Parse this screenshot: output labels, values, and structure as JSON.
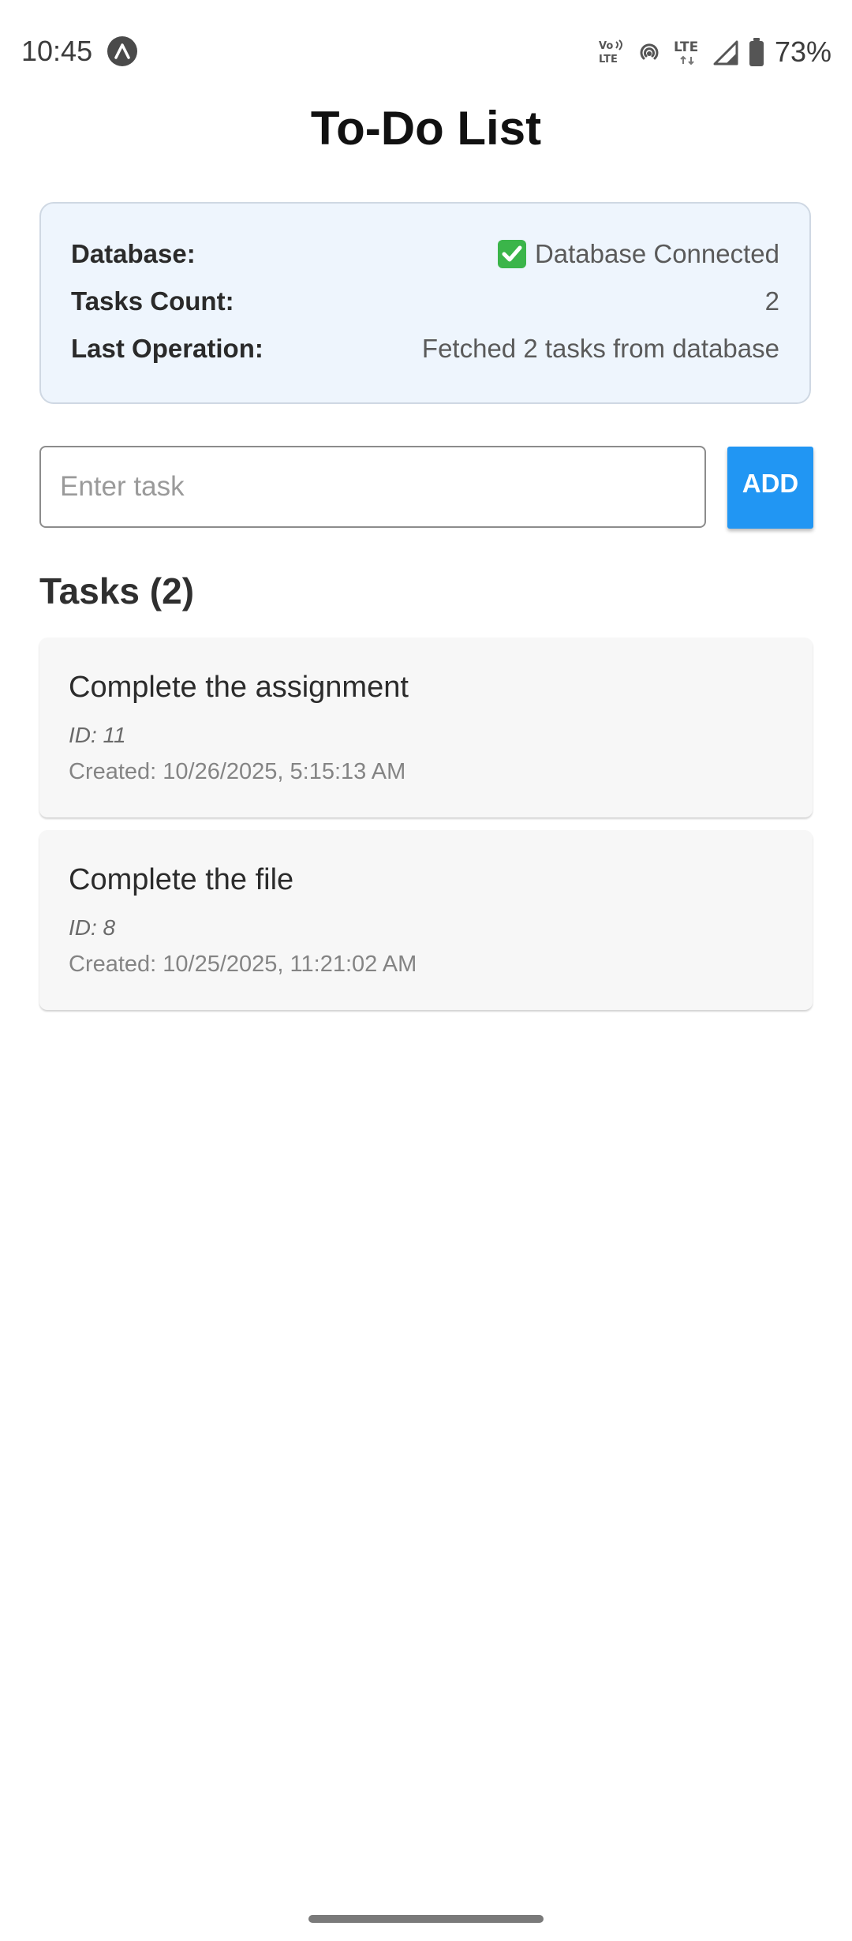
{
  "status_bar": {
    "time": "10:45",
    "battery_percent": "73%",
    "icons": [
      "app-notification-icon",
      "volte-icon",
      "hotspot-icon",
      "lte-icon",
      "signal-icon",
      "battery-icon"
    ],
    "volte_text": "VoLTE",
    "lte_text": "LTE"
  },
  "page": {
    "title": "To-Do List"
  },
  "info_card": {
    "database_label": "Database:",
    "database_value": "Database Connected",
    "database_status_icon": "check-mark-icon",
    "tasks_count_label": "Tasks Count:",
    "tasks_count_value": "2",
    "last_operation_label": "Last Operation:",
    "last_operation_value": "Fetched 2 tasks from database"
  },
  "input": {
    "placeholder": "Enter task",
    "value": "",
    "add_label": "ADD"
  },
  "tasks": {
    "heading": "Tasks (2)",
    "items": [
      {
        "title": "Complete the assignment",
        "id_text": "ID: 11",
        "created_text": "Created: 10/26/2025, 5:15:13 AM"
      },
      {
        "title": "Complete the file",
        "id_text": "ID: 8",
        "created_text": "Created: 10/25/2025, 11:21:02 AM"
      }
    ]
  },
  "colors": {
    "accent": "#2196f3",
    "info_card_bg": "#eef5fd",
    "check_green": "#3bb54a"
  }
}
